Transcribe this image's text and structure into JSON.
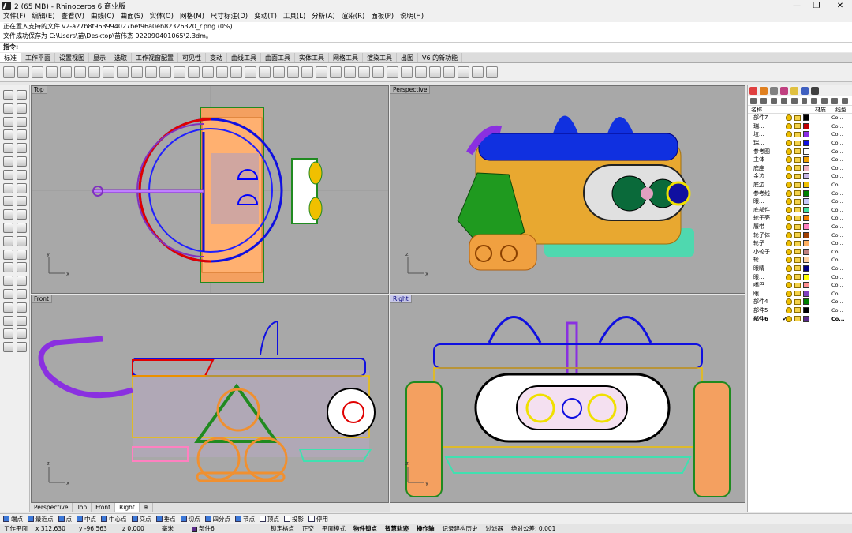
{
  "window": {
    "title": "2 (65 MB) - Rhinoceros 6 商业版",
    "minimize": "—",
    "maximize": "❐",
    "close": "✕"
  },
  "menu": [
    "文件(F)",
    "编辑(E)",
    "查看(V)",
    "曲线(C)",
    "曲面(S)",
    "实体(O)",
    "网格(M)",
    "尺寸标注(D)",
    "变动(T)",
    "工具(L)",
    "分析(A)",
    "渲染(R)",
    "面板(P)",
    "说明(H)"
  ],
  "command": {
    "line1": "正在置入支持的文件 v2-a27b8f963994027bef96a0eb82326320_r.png (0%)",
    "line2": "文件成功保存为 C:\\Users\\苗\\Desktop\\苗伟杰 922090401065\\2.3dm。",
    "prompt": "指令:"
  },
  "tabs": [
    "标准",
    "工作平面",
    "设置视图",
    "显示",
    "选取",
    "工作视窗配置",
    "可见性",
    "变动",
    "曲线工具",
    "曲面工具",
    "实体工具",
    "网格工具",
    "渲染工具",
    "出图",
    "V6 的新功能"
  ],
  "viewports": {
    "top": "Top",
    "perspective": "Perspective",
    "front": "Front",
    "right": "Right"
  },
  "viewport_tabs": [
    "Perspective",
    "Top",
    "Front",
    "Right",
    "⊕"
  ],
  "axes": {
    "x": "x",
    "y": "y",
    "z": "z"
  },
  "layers_panel": {
    "header": {
      "name": "名称",
      "material": "材质",
      "linetype": "线型"
    },
    "rows": [
      {
        "name": "部件7",
        "color": "#000000",
        "mat": "",
        "type": "Co..."
      },
      {
        "name": "瑞...",
        "color": "#c00000",
        "mat": "",
        "type": "Co..."
      },
      {
        "name": "垃...",
        "color": "#8a2be2",
        "mat": "",
        "type": "Co..."
      },
      {
        "name": "瑞...",
        "color": "#1010e0",
        "mat": "",
        "type": "Co..."
      },
      {
        "name": "参考图",
        "color": "#ffffff",
        "mat": "",
        "type": "Co..."
      },
      {
        "name": "主体",
        "color": "#f0a000",
        "mat": "",
        "type": "Co..."
      },
      {
        "name": "底座",
        "color": "#f0b0c0",
        "mat": "",
        "type": "Co..."
      },
      {
        "name": "金边",
        "color": "#c8b6e6",
        "mat": "",
        "type": "Co..."
      },
      {
        "name": "底边",
        "color": "#f0c000",
        "mat": "",
        "type": "Co..."
      },
      {
        "name": "参考线",
        "color": "#008000",
        "mat": "",
        "type": "Co..."
      },
      {
        "name": "眼...",
        "color": "#c8c8ff",
        "mat": "",
        "type": "Co..."
      },
      {
        "name": "底部件",
        "color": "#40e0a0",
        "mat": "",
        "type": "Co..."
      },
      {
        "name": "轮子壳",
        "color": "#f08000",
        "mat": "",
        "type": "Co..."
      },
      {
        "name": "履带",
        "color": "#ff80c0",
        "mat": "",
        "type": "Co..."
      },
      {
        "name": "轮子体",
        "color": "#a04000",
        "mat": "",
        "type": "Co..."
      },
      {
        "name": "轮子",
        "color": "#ffb060",
        "mat": "",
        "type": "Co..."
      },
      {
        "name": "小轮子",
        "color": "#c08080",
        "mat": "",
        "type": "Co..."
      },
      {
        "name": "轮...",
        "color": "#ffd0a0",
        "mat": "",
        "type": "Co..."
      },
      {
        "name": "眼睛",
        "color": "#000080",
        "mat": "",
        "type": "Co..."
      },
      {
        "name": "眼...",
        "color": "#ffff00",
        "mat": "",
        "type": "Co..."
      },
      {
        "name": "嘴巴",
        "color": "#ff9090",
        "mat": "",
        "type": "Co..."
      },
      {
        "name": "眼...",
        "color": "#8040c0",
        "mat": "",
        "type": "Co..."
      },
      {
        "name": "部件4",
        "color": "#008000",
        "mat": "",
        "type": "Co..."
      },
      {
        "name": "部件5",
        "color": "#000000",
        "mat": "",
        "type": "Co..."
      },
      {
        "name": "部件6",
        "color": "#5a2a8a",
        "mat": "",
        "type": "Co...",
        "current": true,
        "check": "✔"
      }
    ]
  },
  "osnaps": [
    {
      "label": "端点",
      "on": true
    },
    {
      "label": "最近点",
      "on": true
    },
    {
      "label": "点",
      "on": true
    },
    {
      "label": "中点",
      "on": true
    },
    {
      "label": "中心点",
      "on": true
    },
    {
      "label": "交点",
      "on": true
    },
    {
      "label": "垂点",
      "on": true
    },
    {
      "label": "切点",
      "on": true
    },
    {
      "label": "四分点",
      "on": true
    },
    {
      "label": "节点",
      "on": true
    },
    {
      "label": "顶点",
      "on": false
    },
    {
      "label": "投影",
      "on": false
    },
    {
      "label": "停用",
      "on": false
    }
  ],
  "status": {
    "cplane": "工作平面",
    "x": "x 312.630",
    "y": "y -96.563",
    "z": "z 0.000",
    "unit": "毫米",
    "layer": "部件6",
    "lockgrid": "锁定格点",
    "ortho": "正交",
    "planar": "平面模式",
    "osnap": "物件锁点",
    "smarttrack": "智慧轨迹",
    "gumball": "操作轴",
    "history": "记录建构历史",
    "filter": "过滤器",
    "tolerance": "绝对公差: 0.001"
  }
}
